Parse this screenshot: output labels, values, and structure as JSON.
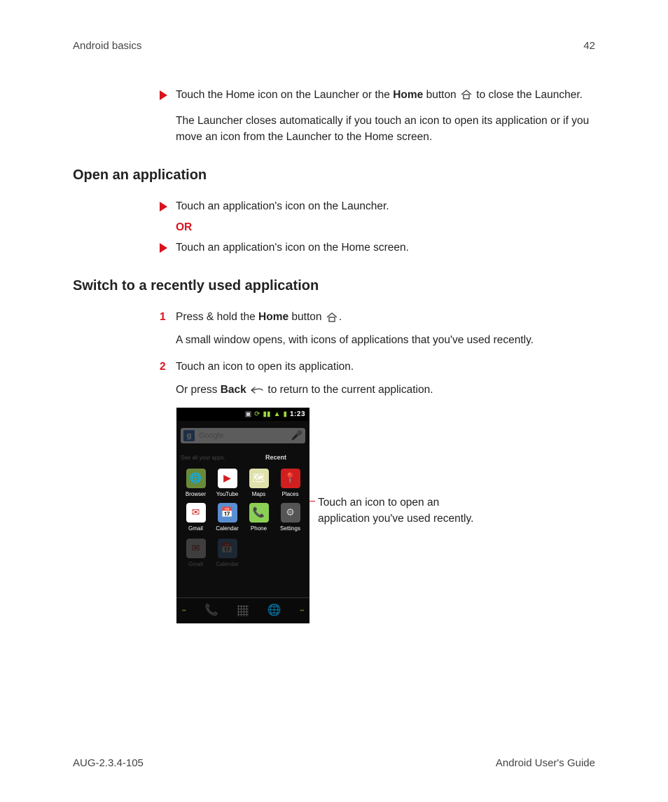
{
  "header": {
    "section": "Android basics",
    "page_number": "42"
  },
  "blocks": {
    "block0": {
      "bullet_pre": "Touch the Home icon on the Launcher or the ",
      "bullet_bold": "Home",
      "bullet_post": " button ",
      "bullet_end": " to close the Launcher.",
      "follow": "The Launcher closes automatically if you touch an icon to open its application or if you move an icon from the Launcher to the Home screen."
    },
    "sec1": {
      "title": "Open an application",
      "b1": "Touch an application's icon on the Launcher.",
      "or": "OR",
      "b2": "Touch an application's icon on the Home screen."
    },
    "sec2": {
      "title": "Switch to a recently used application",
      "n1_pre": "Press & hold the ",
      "n1_bold": "Home",
      "n1_post": " button ",
      "n1_end": ".",
      "n1_follow": "A small window opens, with icons of applications that you've used recently.",
      "n2": "Touch an icon to open its application.",
      "n2_follow_pre": "Or press ",
      "n2_follow_bold": "Back",
      "n2_follow_post": " ",
      "n2_follow_end": " to return to the current application."
    }
  },
  "phone": {
    "clock": "1:23",
    "search_placeholder": "Google",
    "g": "g",
    "see_all": "See all your apps.",
    "recent_title": "Recent",
    "apps": [
      {
        "label": "Browser",
        "bg": "#6a8a3a",
        "glyph": "🌐"
      },
      {
        "label": "YouTube",
        "bg": "#ffffff",
        "glyph": "▶"
      },
      {
        "label": "Maps",
        "bg": "#e0e0ac",
        "glyph": "🗺"
      },
      {
        "label": "Places",
        "bg": "#d11f1f",
        "glyph": "📍"
      },
      {
        "label": "Gmail",
        "bg": "#ffffff",
        "glyph": "✉"
      },
      {
        "label": "Calendar",
        "bg": "#5a8fd1",
        "glyph": "📅"
      },
      {
        "label": "Phone",
        "bg": "#8bd055",
        "glyph": "📞"
      },
      {
        "label": "Settings",
        "bg": "#555555",
        "glyph": "⚙"
      }
    ],
    "dim": [
      {
        "label": "Gmail",
        "bg": "#ffffff",
        "glyph": "✉"
      },
      {
        "label": "Calendar",
        "bg": "#5a8fd1",
        "glyph": "📅"
      }
    ]
  },
  "callout": "Touch an icon to open an application you've used recently.",
  "footer": {
    "left": "AUG-2.3.4-105",
    "right": "Android User's Guide"
  }
}
